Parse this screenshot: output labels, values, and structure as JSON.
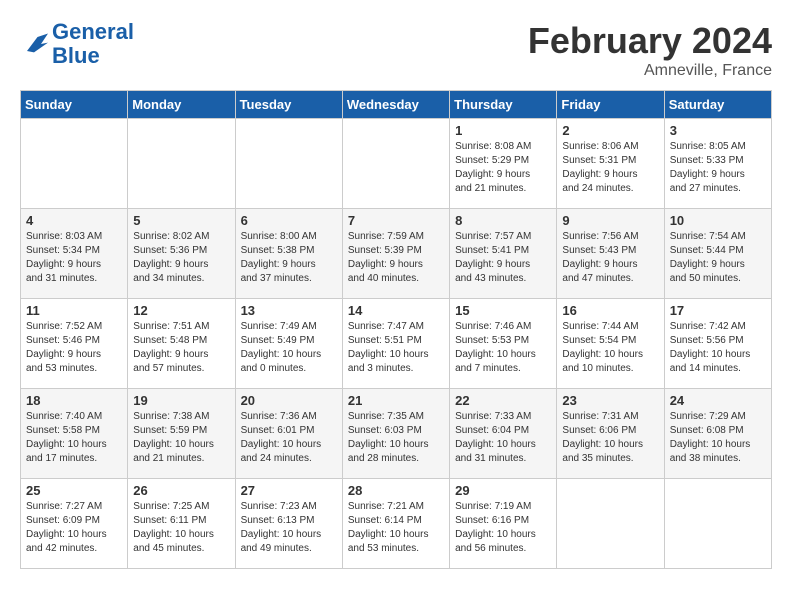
{
  "logo": {
    "general": "General",
    "blue": "Blue"
  },
  "title": "February 2024",
  "subtitle": "Amneville, France",
  "days_of_week": [
    "Sunday",
    "Monday",
    "Tuesday",
    "Wednesday",
    "Thursday",
    "Friday",
    "Saturday"
  ],
  "weeks": [
    [
      {
        "day": "",
        "info": ""
      },
      {
        "day": "",
        "info": ""
      },
      {
        "day": "",
        "info": ""
      },
      {
        "day": "",
        "info": ""
      },
      {
        "day": "1",
        "info": "Sunrise: 8:08 AM\nSunset: 5:29 PM\nDaylight: 9 hours\nand 21 minutes."
      },
      {
        "day": "2",
        "info": "Sunrise: 8:06 AM\nSunset: 5:31 PM\nDaylight: 9 hours\nand 24 minutes."
      },
      {
        "day": "3",
        "info": "Sunrise: 8:05 AM\nSunset: 5:33 PM\nDaylight: 9 hours\nand 27 minutes."
      }
    ],
    [
      {
        "day": "4",
        "info": "Sunrise: 8:03 AM\nSunset: 5:34 PM\nDaylight: 9 hours\nand 31 minutes."
      },
      {
        "day": "5",
        "info": "Sunrise: 8:02 AM\nSunset: 5:36 PM\nDaylight: 9 hours\nand 34 minutes."
      },
      {
        "day": "6",
        "info": "Sunrise: 8:00 AM\nSunset: 5:38 PM\nDaylight: 9 hours\nand 37 minutes."
      },
      {
        "day": "7",
        "info": "Sunrise: 7:59 AM\nSunset: 5:39 PM\nDaylight: 9 hours\nand 40 minutes."
      },
      {
        "day": "8",
        "info": "Sunrise: 7:57 AM\nSunset: 5:41 PM\nDaylight: 9 hours\nand 43 minutes."
      },
      {
        "day": "9",
        "info": "Sunrise: 7:56 AM\nSunset: 5:43 PM\nDaylight: 9 hours\nand 47 minutes."
      },
      {
        "day": "10",
        "info": "Sunrise: 7:54 AM\nSunset: 5:44 PM\nDaylight: 9 hours\nand 50 minutes."
      }
    ],
    [
      {
        "day": "11",
        "info": "Sunrise: 7:52 AM\nSunset: 5:46 PM\nDaylight: 9 hours\nand 53 minutes."
      },
      {
        "day": "12",
        "info": "Sunrise: 7:51 AM\nSunset: 5:48 PM\nDaylight: 9 hours\nand 57 minutes."
      },
      {
        "day": "13",
        "info": "Sunrise: 7:49 AM\nSunset: 5:49 PM\nDaylight: 10 hours\nand 0 minutes."
      },
      {
        "day": "14",
        "info": "Sunrise: 7:47 AM\nSunset: 5:51 PM\nDaylight: 10 hours\nand 3 minutes."
      },
      {
        "day": "15",
        "info": "Sunrise: 7:46 AM\nSunset: 5:53 PM\nDaylight: 10 hours\nand 7 minutes."
      },
      {
        "day": "16",
        "info": "Sunrise: 7:44 AM\nSunset: 5:54 PM\nDaylight: 10 hours\nand 10 minutes."
      },
      {
        "day": "17",
        "info": "Sunrise: 7:42 AM\nSunset: 5:56 PM\nDaylight: 10 hours\nand 14 minutes."
      }
    ],
    [
      {
        "day": "18",
        "info": "Sunrise: 7:40 AM\nSunset: 5:58 PM\nDaylight: 10 hours\nand 17 minutes."
      },
      {
        "day": "19",
        "info": "Sunrise: 7:38 AM\nSunset: 5:59 PM\nDaylight: 10 hours\nand 21 minutes."
      },
      {
        "day": "20",
        "info": "Sunrise: 7:36 AM\nSunset: 6:01 PM\nDaylight: 10 hours\nand 24 minutes."
      },
      {
        "day": "21",
        "info": "Sunrise: 7:35 AM\nSunset: 6:03 PM\nDaylight: 10 hours\nand 28 minutes."
      },
      {
        "day": "22",
        "info": "Sunrise: 7:33 AM\nSunset: 6:04 PM\nDaylight: 10 hours\nand 31 minutes."
      },
      {
        "day": "23",
        "info": "Sunrise: 7:31 AM\nSunset: 6:06 PM\nDaylight: 10 hours\nand 35 minutes."
      },
      {
        "day": "24",
        "info": "Sunrise: 7:29 AM\nSunset: 6:08 PM\nDaylight: 10 hours\nand 38 minutes."
      }
    ],
    [
      {
        "day": "25",
        "info": "Sunrise: 7:27 AM\nSunset: 6:09 PM\nDaylight: 10 hours\nand 42 minutes."
      },
      {
        "day": "26",
        "info": "Sunrise: 7:25 AM\nSunset: 6:11 PM\nDaylight: 10 hours\nand 45 minutes."
      },
      {
        "day": "27",
        "info": "Sunrise: 7:23 AM\nSunset: 6:13 PM\nDaylight: 10 hours\nand 49 minutes."
      },
      {
        "day": "28",
        "info": "Sunrise: 7:21 AM\nSunset: 6:14 PM\nDaylight: 10 hours\nand 53 minutes."
      },
      {
        "day": "29",
        "info": "Sunrise: 7:19 AM\nSunset: 6:16 PM\nDaylight: 10 hours\nand 56 minutes."
      },
      {
        "day": "",
        "info": ""
      },
      {
        "day": "",
        "info": ""
      }
    ]
  ]
}
